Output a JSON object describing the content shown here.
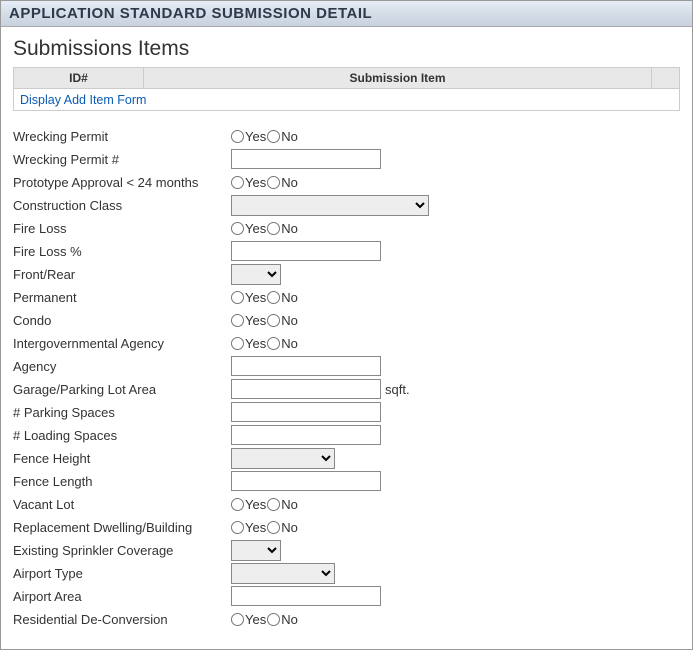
{
  "header": {
    "title": "APPLICATION STANDARD SUBMISSION DETAIL"
  },
  "section": {
    "title": "Submissions Items"
  },
  "table": {
    "col_id": "ID#",
    "col_item": "Submission Item",
    "link": "Display Add Item Form"
  },
  "radios": {
    "yes": "Yes",
    "no": "No"
  },
  "fields": {
    "wrecking_permit": {
      "label": "Wrecking Permit"
    },
    "wrecking_permit_no": {
      "label": "Wrecking Permit #",
      "value": ""
    },
    "prototype_approval": {
      "label": "Prototype Approval < 24 months"
    },
    "construction_class": {
      "label": "Construction Class",
      "value": ""
    },
    "fire_loss": {
      "label": "Fire Loss"
    },
    "fire_loss_pct": {
      "label": "Fire Loss %",
      "value": ""
    },
    "front_rear": {
      "label": "Front/Rear",
      "value": ""
    },
    "permanent": {
      "label": "Permanent"
    },
    "condo": {
      "label": "Condo"
    },
    "intergov_agency": {
      "label": "Intergovernmental Agency"
    },
    "agency": {
      "label": "Agency",
      "value": ""
    },
    "garage_area": {
      "label": "Garage/Parking Lot Area",
      "value": "",
      "suffix": "sqft."
    },
    "parking_spaces": {
      "label": "# Parking Spaces",
      "value": ""
    },
    "loading_spaces": {
      "label": "# Loading Spaces",
      "value": ""
    },
    "fence_height": {
      "label": "Fence Height",
      "value": ""
    },
    "fence_length": {
      "label": "Fence Length",
      "value": ""
    },
    "vacant_lot": {
      "label": "Vacant Lot"
    },
    "replacement_dwelling": {
      "label": "Replacement Dwelling/Building"
    },
    "sprinkler_coverage": {
      "label": "Existing Sprinkler Coverage",
      "value": ""
    },
    "airport_type": {
      "label": "Airport Type",
      "value": ""
    },
    "airport_area": {
      "label": "Airport Area",
      "value": ""
    },
    "residential_deconv": {
      "label": "Residential De-Conversion"
    }
  }
}
